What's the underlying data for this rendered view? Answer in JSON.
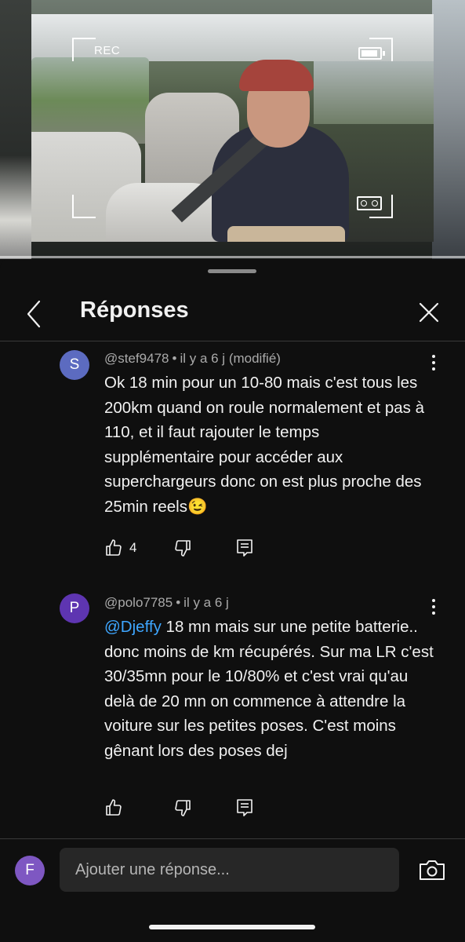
{
  "video": {
    "rec_label": "REC",
    "progress": 1.0
  },
  "header": {
    "title": "Réponses"
  },
  "comments": [
    {
      "avatar_letter": "S",
      "avatar_color": "#5c6bc0",
      "author": "@stef9478",
      "time": "il y a 6 j",
      "edited": "(modifié)",
      "text": "Ok 18 min pour un 10-80 mais c'est tous les 200km quand on roule normalement et pas à 110, et il faut rajouter le temps supplémentaire pour accéder aux superchargeurs donc on est plus proche des 25min reels",
      "emoji": "😉",
      "likes": "4"
    },
    {
      "avatar_letter": "P",
      "avatar_color": "#5e35b1",
      "author": "@polo7785",
      "time": "il y a 6 j",
      "mention": "@Djeffy",
      "text": " 18 mn mais sur une petite batterie.. donc moins de km récupérés. Sur ma LR c'est 30/35mn pour le 10/80% et c'est vrai qu'au delà de 20 mn on commence à attendre la voiture sur les petites poses. C'est moins gênant lors des poses dej",
      "likes": ""
    }
  ],
  "reply": {
    "avatar_letter": "F",
    "placeholder": "Ajouter une réponse..."
  },
  "colors": {
    "background": "#0f0f0f",
    "mention": "#3ea6ff",
    "input_bg": "#272727"
  },
  "icons": [
    "back-icon",
    "close-icon",
    "more-vert-icon",
    "thumb-up-icon",
    "thumb-down-icon",
    "reply-icon",
    "camera-icon"
  ]
}
